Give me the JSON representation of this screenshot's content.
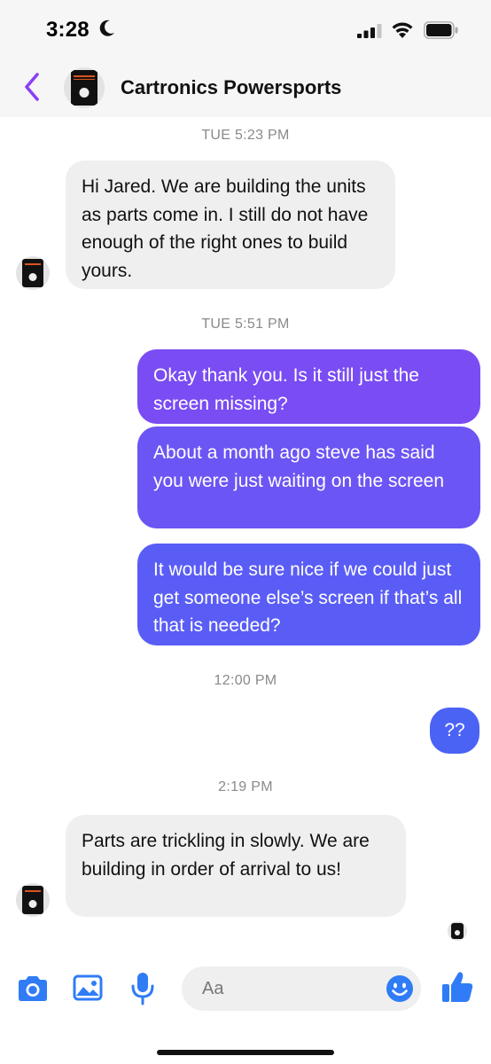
{
  "status_bar": {
    "time": "3:28"
  },
  "header": {
    "title": "Cartronics Powersports"
  },
  "messages": [
    {
      "type": "timestamp",
      "text": "TUE 5:23 PM"
    },
    {
      "type": "incoming",
      "text": "Hi Jared. We are building the units as parts come in. I still do not have enough of the right ones to build yours."
    },
    {
      "type": "timestamp",
      "text": "TUE 5:51 PM"
    },
    {
      "type": "outgoing",
      "text": "Okay thank you. Is it still just the screen missing?"
    },
    {
      "type": "outgoing",
      "text": "About a month ago steve has said you were just waiting on the screen"
    },
    {
      "type": "outgoing",
      "text": "It would be sure nice if we could just get someone else’s screen if that’s all that is needed?"
    },
    {
      "type": "timestamp",
      "text": "12:00 PM"
    },
    {
      "type": "outgoing",
      "text": "??"
    },
    {
      "type": "timestamp",
      "text": "2:19 PM"
    },
    {
      "type": "incoming",
      "text": "Parts are trickling in slowly. We are building in order of arrival to us!"
    }
  ],
  "composer": {
    "placeholder": "Aa"
  },
  "colors": {
    "accent": "#8a3ff5",
    "outgoing_top": "#7a4cf3",
    "outgoing_bottom": "#4a63f5",
    "icon_blue": "#2f7cf6",
    "incoming_bg": "#efefef",
    "timestamp": "#8a8a8e"
  },
  "icons": [
    "moon-icon",
    "signal-icon",
    "wifi-icon",
    "battery-icon",
    "back-chevron-icon",
    "camera-icon",
    "photo-icon",
    "microphone-icon",
    "emoji-icon",
    "thumbs-up-icon"
  ]
}
